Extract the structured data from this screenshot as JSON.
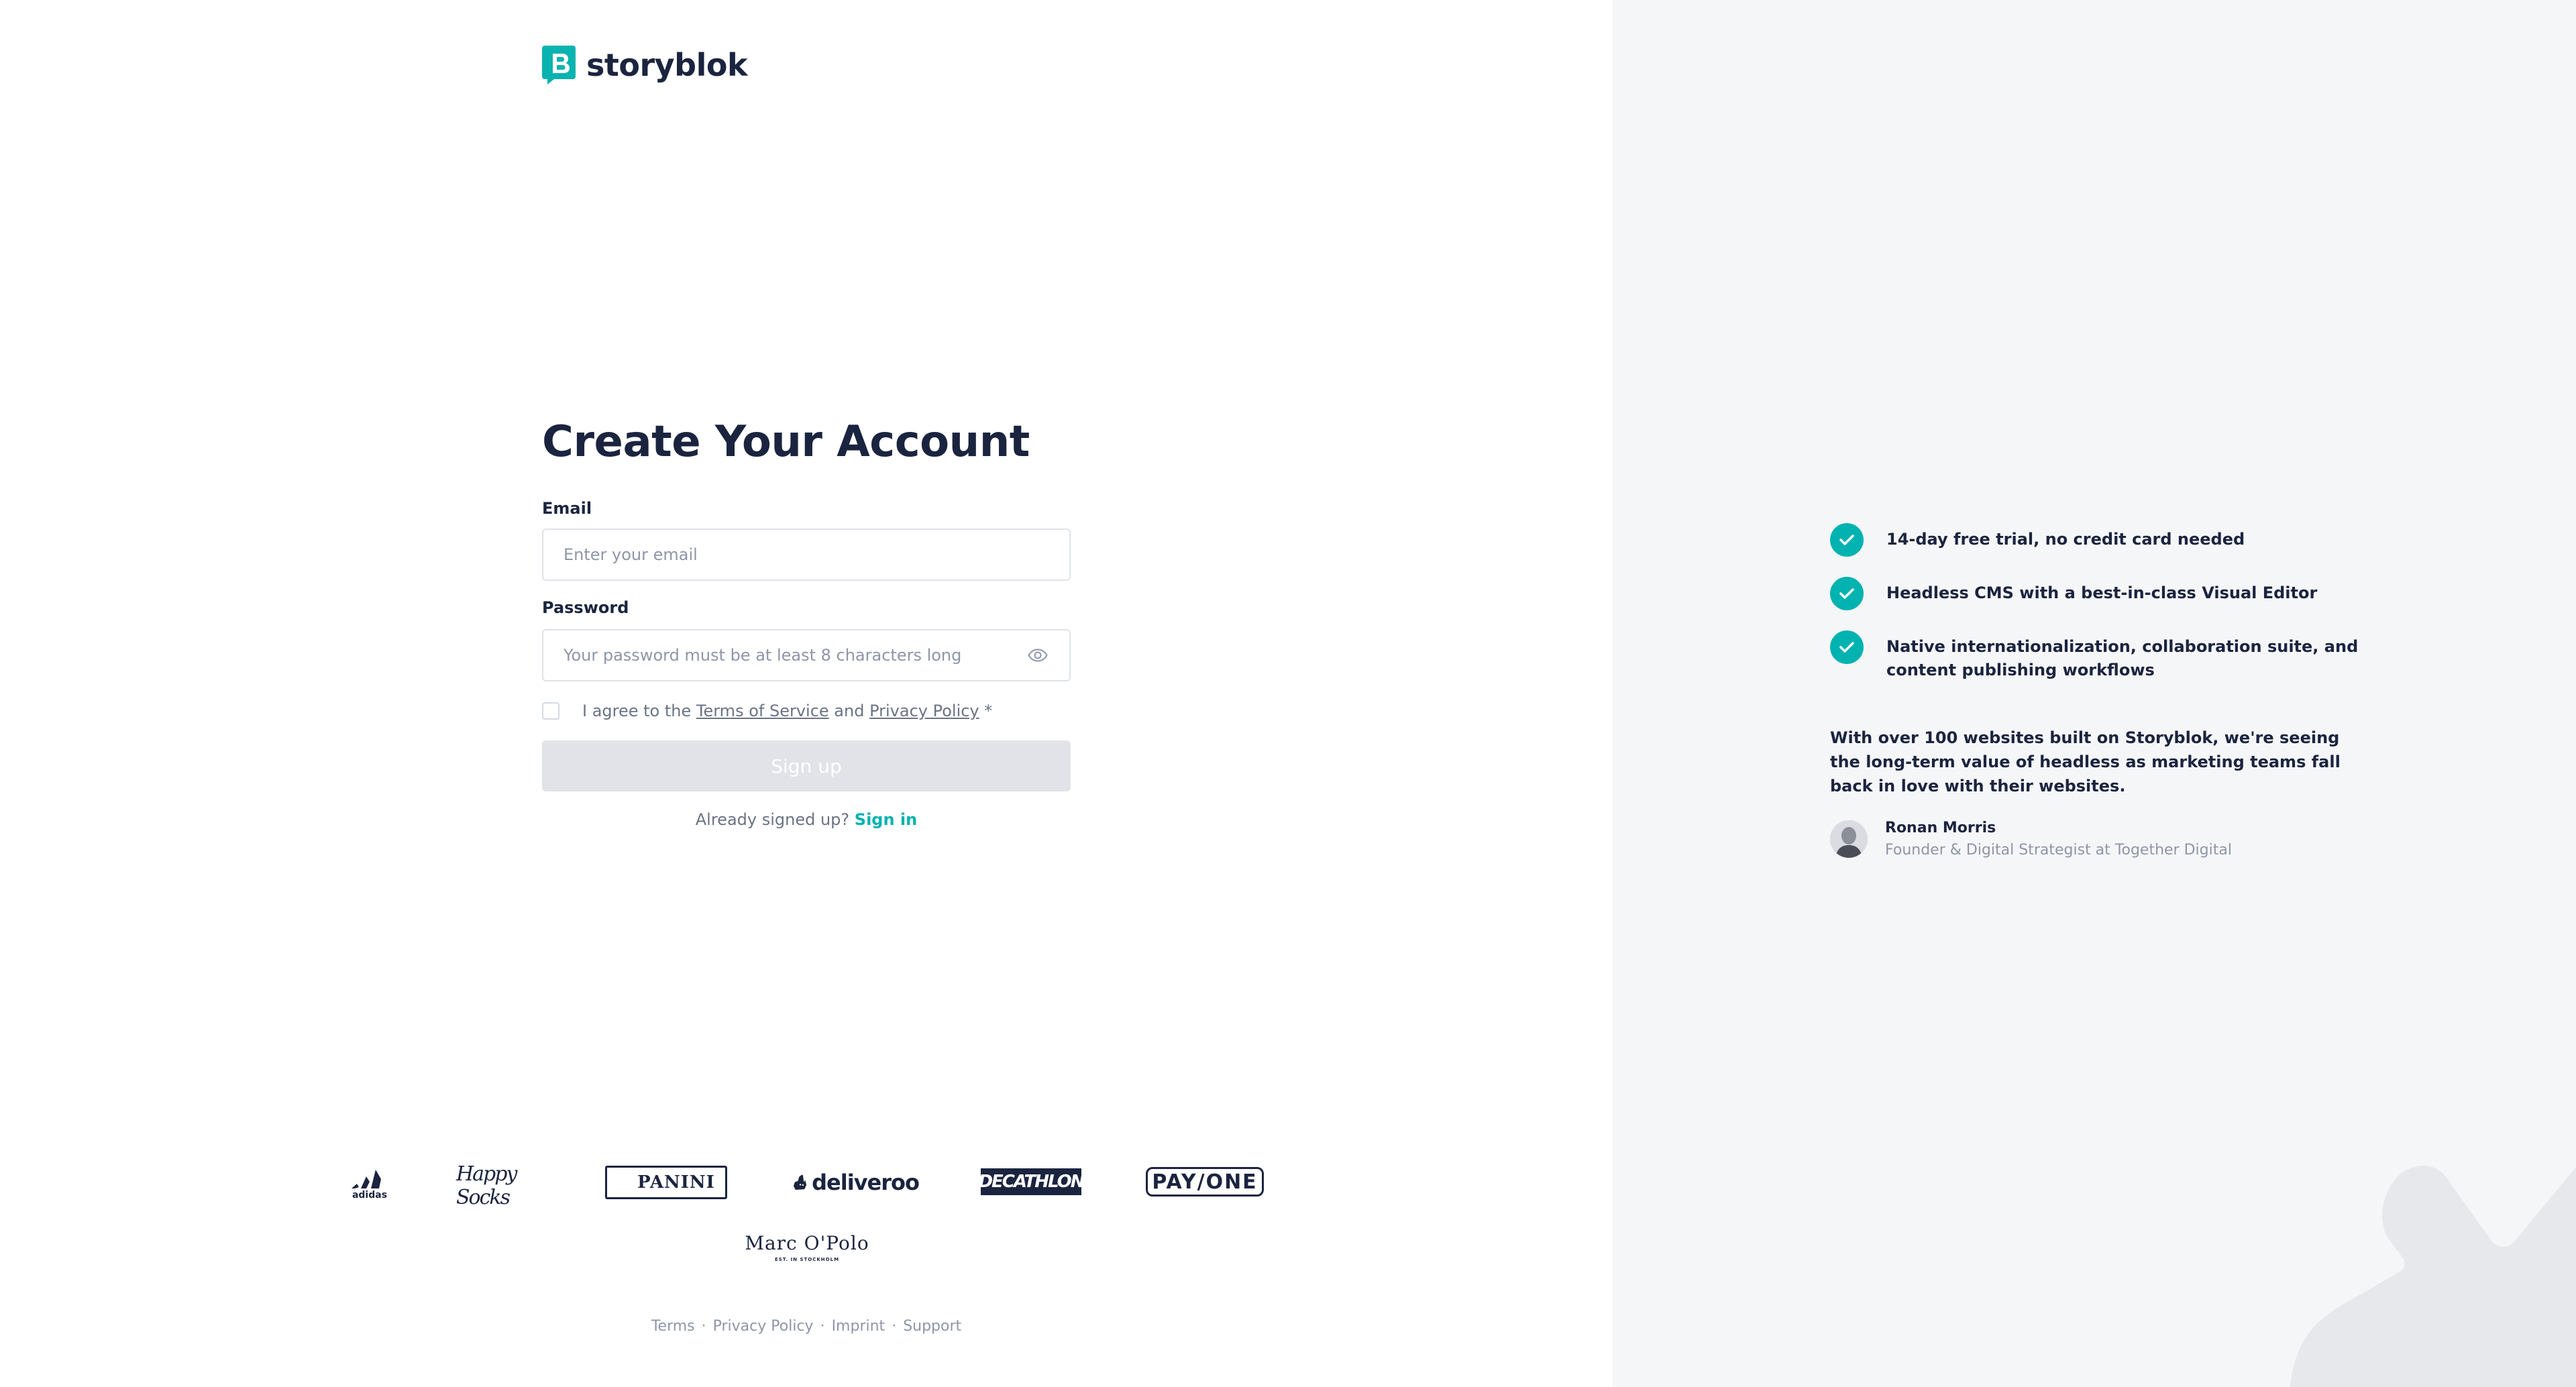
{
  "brand": {
    "name": "storyblok"
  },
  "form": {
    "title": "Create Your Account",
    "email_label": "Email",
    "email_placeholder": "Enter your email",
    "password_label": "Password",
    "password_placeholder": "Your password must be at least 8 characters long",
    "agree_prefix": "I agree to the ",
    "terms_link": "Terms of Service",
    "agree_and": " and ",
    "privacy_link": "Privacy Policy",
    "agree_suffix": " *",
    "signup_label": "Sign up",
    "already_text": "Already signed up?",
    "signin_label": "Sign in"
  },
  "customers": [
    "adidas",
    "Happy Socks",
    "PANINI",
    "deliveroo",
    "DECATHLON",
    "PAY/ONE",
    "Marc O'Polo",
    "EST. IN STOCKHOLM"
  ],
  "footer": {
    "links": [
      "Terms",
      "Privacy Policy",
      "Imprint",
      "Support"
    ],
    "separator": "·"
  },
  "features": [
    "14-day free trial, no credit card needed",
    "Headless CMS with a best-in-class Visual Editor",
    "Native internationalization, collaboration suite, and content publishing workflows"
  ],
  "testimonial": {
    "quote_before": "With over ",
    "quote_bold": "100",
    "quote_after": " websites built on Storyblok, we're seeing the long-term value of headless as marketing teams fall back in love with their websites.",
    "name": "Ronan Morris",
    "role": "Founder & Digital Strategist at Together Digital"
  },
  "colors": {
    "accent": "#00b3b0",
    "text": "#1b243f",
    "muted": "#8d96a8",
    "panel": "#f5f6f8",
    "button_disabled": "#e1e3e8"
  }
}
